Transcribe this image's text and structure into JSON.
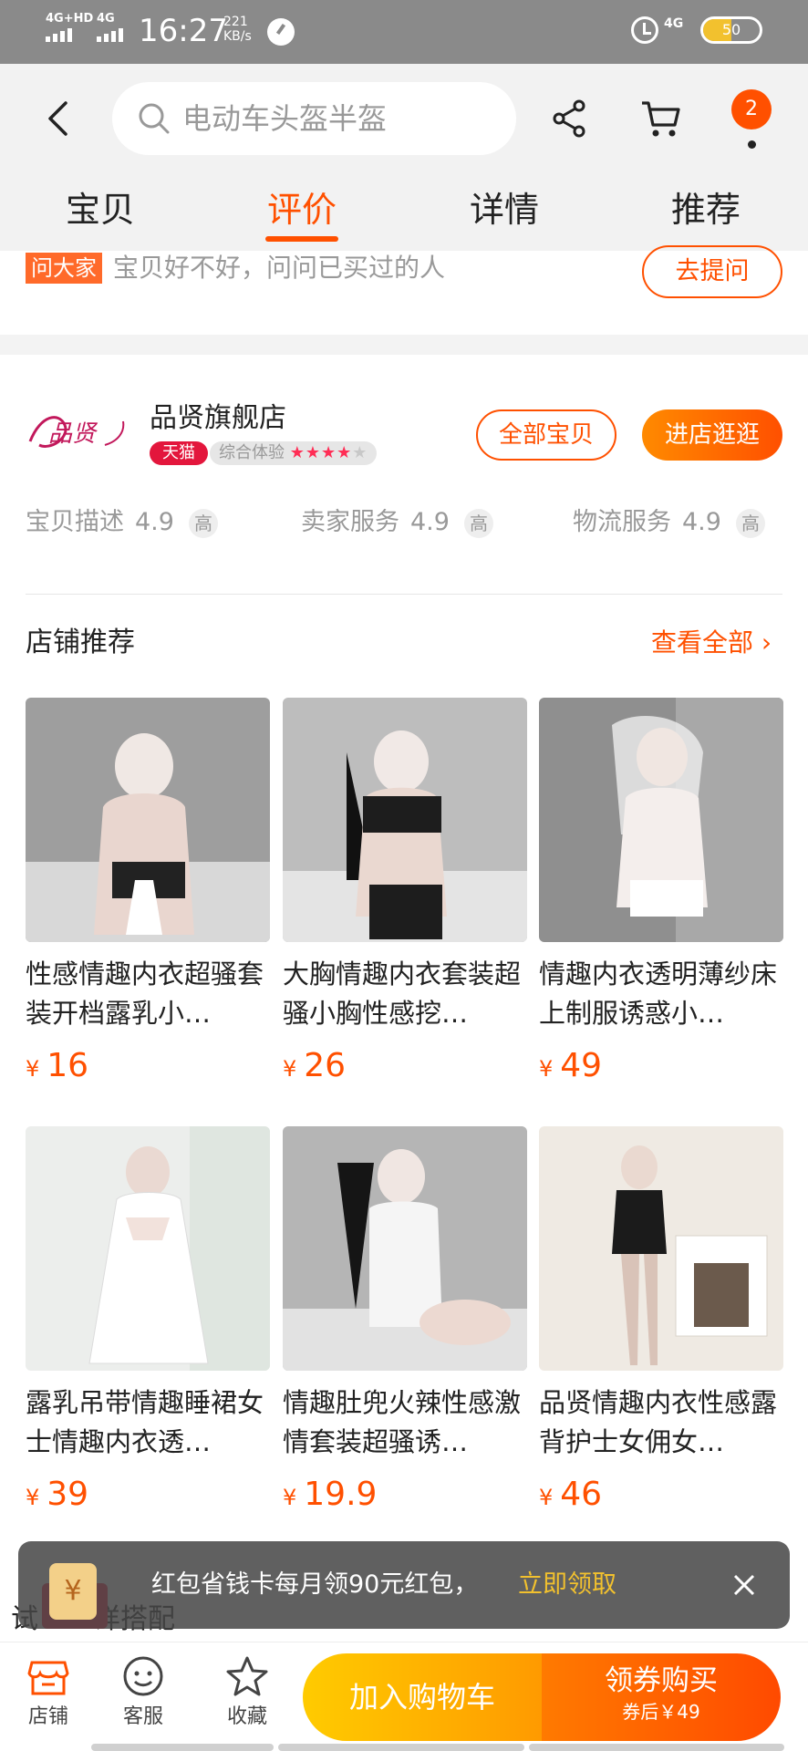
{
  "status_bar": {
    "net1": "4G+HD",
    "net2": "4G",
    "time": "16:27",
    "speed_value": "221",
    "speed_unit": "KB/s",
    "net_right": "4G",
    "battery_level": "50",
    "battery_fraction": 0.5
  },
  "header": {
    "search_placeholder": "电动车头盔半盔",
    "cart_badge": "2"
  },
  "tabs": [
    {
      "label": "宝贝"
    },
    {
      "label": "评价",
      "active": true
    },
    {
      "label": "详情"
    },
    {
      "label": "推荐"
    }
  ],
  "ask": {
    "tag": "问大家",
    "text": "宝贝好不好，问问已买过的人",
    "button": "去提问"
  },
  "shop": {
    "name": "品贤旗舰店",
    "logo_text": "品贤",
    "tmall_badge": "天猫",
    "rating_label": "综合体验",
    "rating_stars": 4,
    "rating_max": 5,
    "all_items_button": "全部宝贝",
    "enter_button": "进店逛逛",
    "scores": [
      {
        "label": "宝贝描述",
        "value": "4.9",
        "level": "高"
      },
      {
        "label": "卖家服务",
        "value": "4.9",
        "level": "高"
      },
      {
        "label": "物流服务",
        "value": "4.9",
        "level": "高"
      }
    ]
  },
  "recommend": {
    "heading": "店铺推荐",
    "view_all": "查看全部",
    "products": [
      {
        "title": "性感情趣内衣超骚套装开档露乳小…",
        "currency": "¥",
        "price": "16"
      },
      {
        "title": "大胸情趣内衣套装超骚小胸性感挖…",
        "currency": "¥",
        "price": "26"
      },
      {
        "title": "情趣内衣透明薄纱床上制服诱惑小…",
        "currency": "¥",
        "price": "49"
      },
      {
        "title": "露乳吊带情趣睡裙女士情趣内衣透…",
        "currency": "¥",
        "price": "39"
      },
      {
        "title": "情趣肚兜火辣性感激情套装超骚诱…",
        "currency": "¥",
        "price": "19.9"
      },
      {
        "title": "品贤情趣内衣性感露背护士女佣女…",
        "currency": "¥",
        "price": "46"
      }
    ]
  },
  "redpack": {
    "icon_text": "¥",
    "text": "红包省钱卡每月领90元红包，",
    "link": "立即领取"
  },
  "peek_text": "试　　详搭配",
  "bottom_bar": {
    "shop": "店铺",
    "service": "客服",
    "favorite": "收藏",
    "add_cart": "加入购物车",
    "buy": "领券购买",
    "buy_sub": "券后￥49"
  },
  "colors": {
    "accent": "#ff5000",
    "tmall": "#e3163c",
    "highlight": "#f2c12e"
  }
}
